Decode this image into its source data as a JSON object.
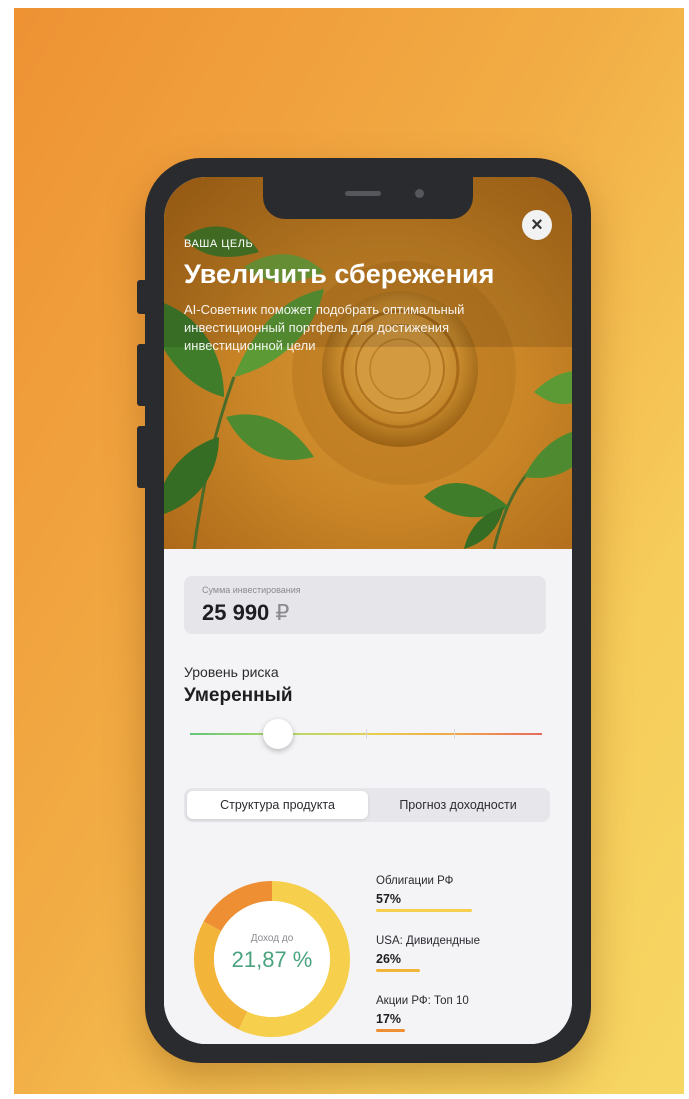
{
  "hero": {
    "eyebrow": "ВАША ЦЕЛЬ",
    "title": "Увеличить сбережения",
    "subtitle": "AI-Советник поможет подобрать оптимальный инвестиционный портфель для достижения инвестиционной цели",
    "close_icon": "×"
  },
  "amount": {
    "label": "Сумма инвестирования",
    "value": "25 990",
    "currency": "₽"
  },
  "risk": {
    "label": "Уровень риска",
    "value": "Умеренный",
    "slider_level_fraction": 0.25
  },
  "tabs": [
    {
      "label": "Структура продукта",
      "active": true
    },
    {
      "label": "Прогноз доходности",
      "active": false
    }
  ],
  "donut": {
    "caption": "Доход до",
    "value": "21,87 %"
  },
  "allocation": [
    {
      "name": "Облигации РФ",
      "percent_label": "57%",
      "value": 57,
      "color": "#f6d04d"
    },
    {
      "name": "USA: Дивидендные",
      "percent_label": "26%",
      "value": 26,
      "color": "#f3b43a"
    },
    {
      "name": "Акции РФ: Топ 10",
      "percent_label": "17%",
      "value": 17,
      "color": "#ee8f34"
    }
  ],
  "colors": {
    "background_start": "#ee9234",
    "background_end": "#f7d764",
    "accent_green": "#4aa37e"
  }
}
